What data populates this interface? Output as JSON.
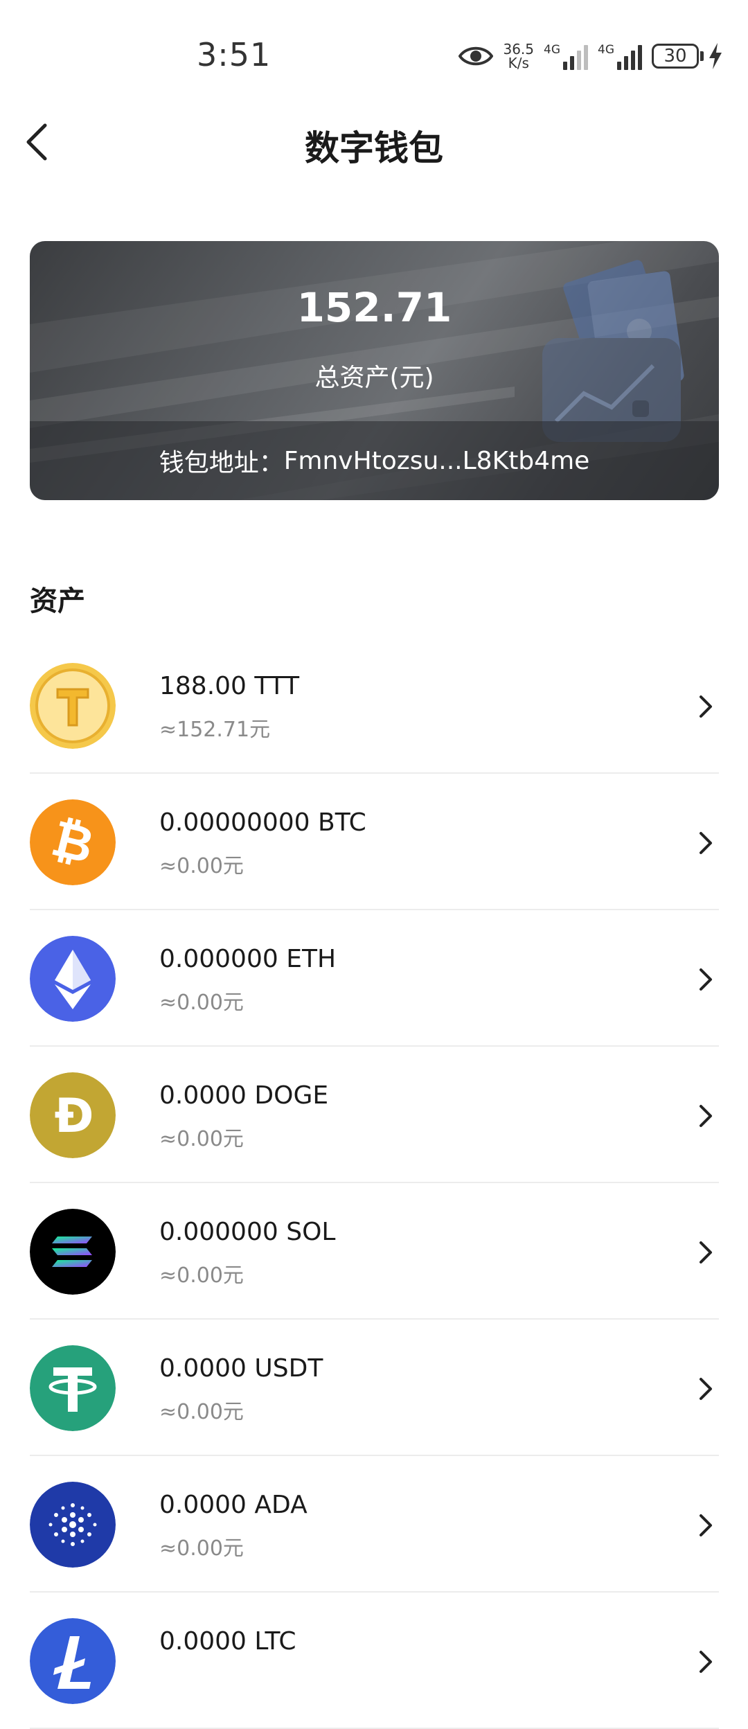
{
  "status": {
    "time": "3:51",
    "net_speed_value": "36.5",
    "net_speed_unit": "K/s",
    "signal1_label": "4G",
    "signal2_label": "4G",
    "battery": "30"
  },
  "header": {
    "title": "数字钱包"
  },
  "wallet": {
    "total": "152.71",
    "total_label": "总资产(元)",
    "address_label": "钱包地址：",
    "address": "FmnvHtozsu...L8Ktb4me"
  },
  "assets": {
    "section_title": "资产",
    "items": [
      {
        "amount": "188.00 TTT",
        "value": "≈152.71元",
        "symbol": "TTT",
        "color": "#f3c64a"
      },
      {
        "amount": "0.00000000 BTC",
        "value": "≈0.00元",
        "symbol": "BTC",
        "color": "#f7931a"
      },
      {
        "amount": "0.000000 ETH",
        "value": "≈0.00元",
        "symbol": "ETH",
        "color": "#4a62e6"
      },
      {
        "amount": "0.0000 DOGE",
        "value": "≈0.00元",
        "symbol": "DOGE",
        "color": "#c2a633"
      },
      {
        "amount": "0.000000 SOL",
        "value": "≈0.00元",
        "symbol": "SOL",
        "color": "#000000"
      },
      {
        "amount": "0.0000 USDT",
        "value": "≈0.00元",
        "symbol": "USDT",
        "color": "#26a17b"
      },
      {
        "amount": "0.0000 ADA",
        "value": "≈0.00元",
        "symbol": "ADA",
        "color": "#1f3aa8"
      },
      {
        "amount": "0.0000 LTC",
        "value": "",
        "symbol": "LTC",
        "color": "#345d9d"
      }
    ]
  }
}
